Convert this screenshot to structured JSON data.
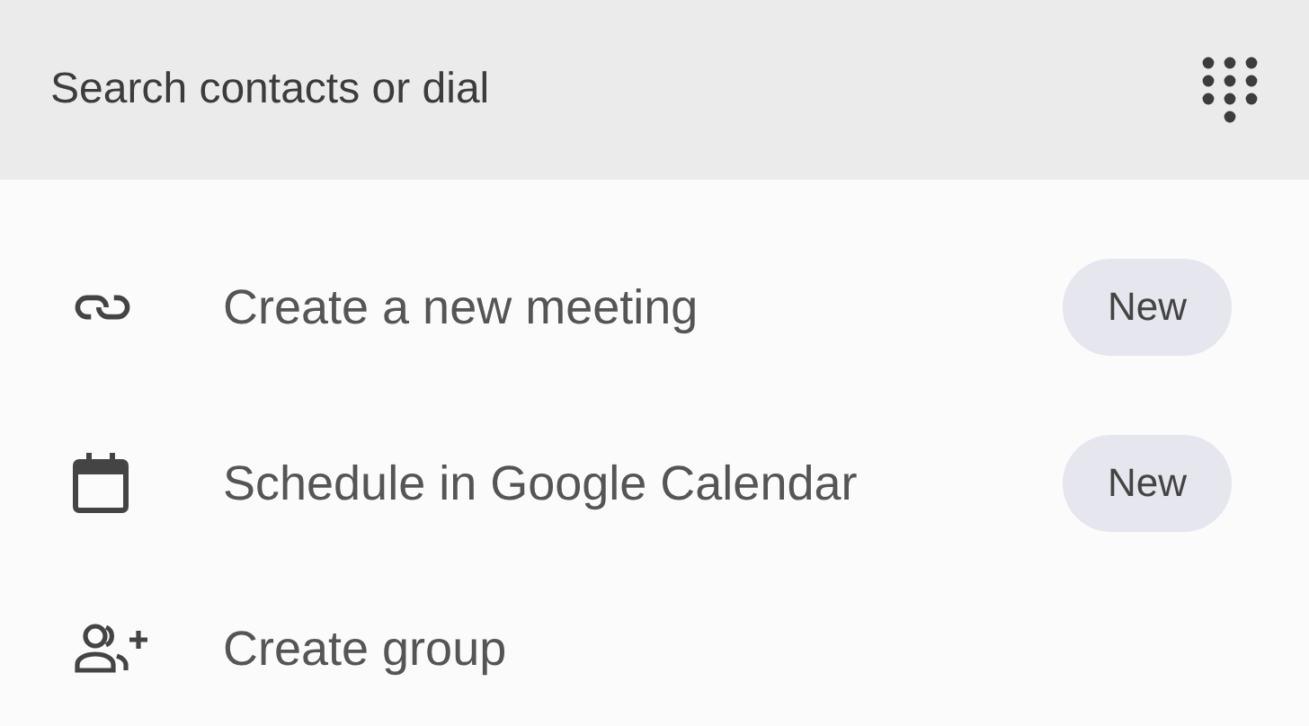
{
  "search": {
    "placeholder": "Search contacts or dial"
  },
  "items": [
    {
      "kind": "link",
      "label": "Create a new meeting",
      "badge": "New"
    },
    {
      "kind": "calendar",
      "label": "Schedule in Google Calendar",
      "badge": "New"
    },
    {
      "kind": "group",
      "label": "Create group"
    }
  ]
}
